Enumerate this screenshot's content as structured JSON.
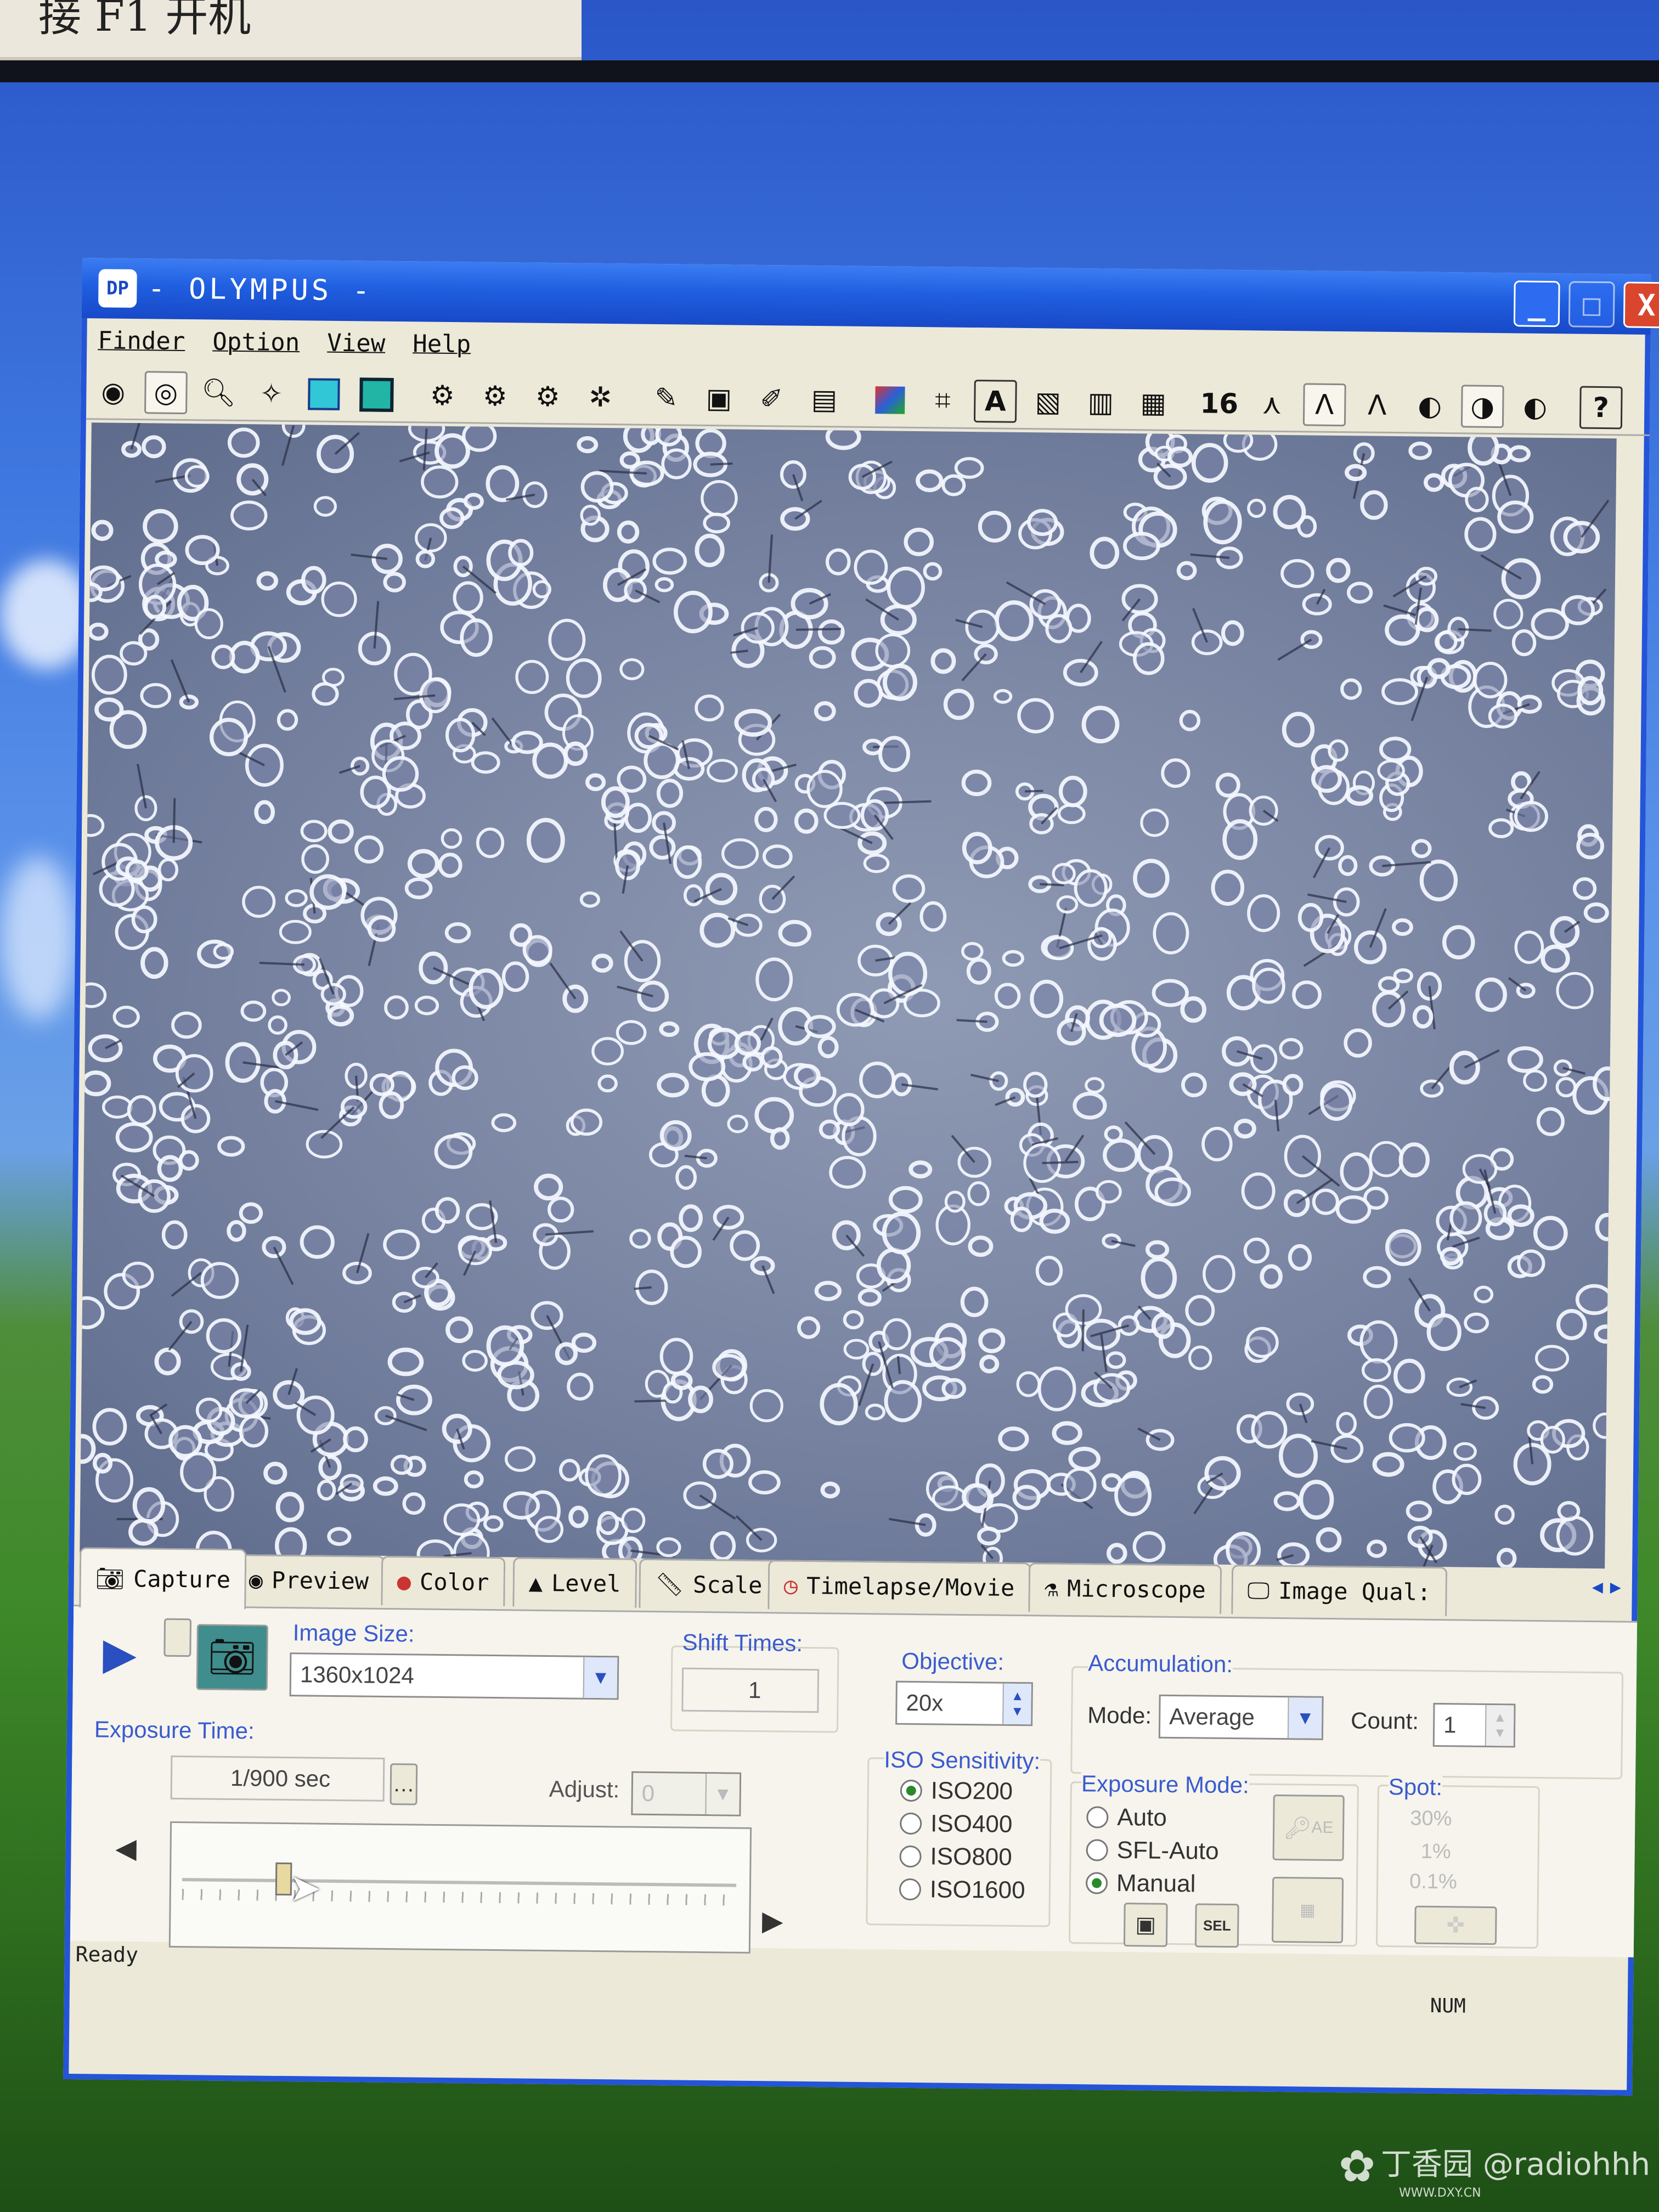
{
  "note": {
    "text": "接 F1 开机"
  },
  "window": {
    "title": "- OLYMPUS -",
    "icon": "microscope-app-icon",
    "minimize": "_",
    "maximize": "□",
    "close": "X"
  },
  "menu": [
    "Finder",
    "Option",
    "View",
    "Help"
  ],
  "toolbar": {
    "icons": [
      "camera-icon",
      "eye-icon",
      "zoom-icon",
      "focus-icon",
      "frame-cyan-icon",
      "frame-teal-icon",
      "settings-1-icon",
      "settings-2-icon",
      "settings-3-icon",
      "bug-icon",
      "pencil-icon",
      "disk-icon",
      "edit-icon",
      "save-icon",
      "color-icon",
      "crop-icon",
      "text-a-icon",
      "image-a-icon",
      "film-icon",
      "stack-icon",
      "bit16-icon",
      "gamma-1-icon",
      "gamma-2-icon",
      "gamma-3-icon",
      "contrast-1-icon",
      "contrast-2-icon",
      "contrast-3-icon",
      "help-icon"
    ],
    "bit_label": "16",
    "help_label": "?"
  },
  "tabs": [
    {
      "label": "Capture",
      "icon": "camera-icon"
    },
    {
      "label": "Preview",
      "icon": "eye-icon"
    },
    {
      "label": "Color",
      "icon": "rgb-icon"
    },
    {
      "label": "Level",
      "icon": "histogram-icon"
    },
    {
      "label": "Scale",
      "icon": "ruler-icon"
    },
    {
      "label": "Timelapse/Movie",
      "icon": "clock-icon"
    },
    {
      "label": "Microscope",
      "icon": "microscope-icon"
    },
    {
      "label": "Image Qual:",
      "icon": "monitor-icon"
    }
  ],
  "capture": {
    "image_size_label": "Image Size:",
    "image_size_value": "1360x1024",
    "exposure_time_label": "Exposure Time:",
    "exposure_time_value": "1/900 sec",
    "adjust_label": "Adjust:",
    "adjust_value": "0",
    "shift_times_label": "Shift Times:",
    "shift_times_value": "1",
    "objective_label": "Objective:",
    "objective_value": "20x",
    "iso_label": "ISO Sensitivity:",
    "iso_options": [
      "ISO200",
      "ISO400",
      "ISO800",
      "ISO1600"
    ],
    "iso_selected": "ISO200",
    "accumulation_label": "Accumulation:",
    "mode_label": "Mode:",
    "mode_value": "Average",
    "count_label": "Count:",
    "count_value": "1",
    "exposure_mode_label": "Exposure Mode:",
    "exposure_mode_options": [
      "Auto",
      "SFL-Auto",
      "Manual"
    ],
    "exposure_mode_selected": "Manual",
    "spot_label": "Spot:",
    "spot_options": [
      "30%",
      "1%",
      "0.1%"
    ],
    "ae_button": "AE",
    "sel_button": "SEL",
    "slider_position": 0.17
  },
  "status": {
    "text": "Ready",
    "num": "NUM"
  },
  "watermark": {
    "text": "丁香园 @radiohhh",
    "sub": "WWW.DXY.CN"
  }
}
